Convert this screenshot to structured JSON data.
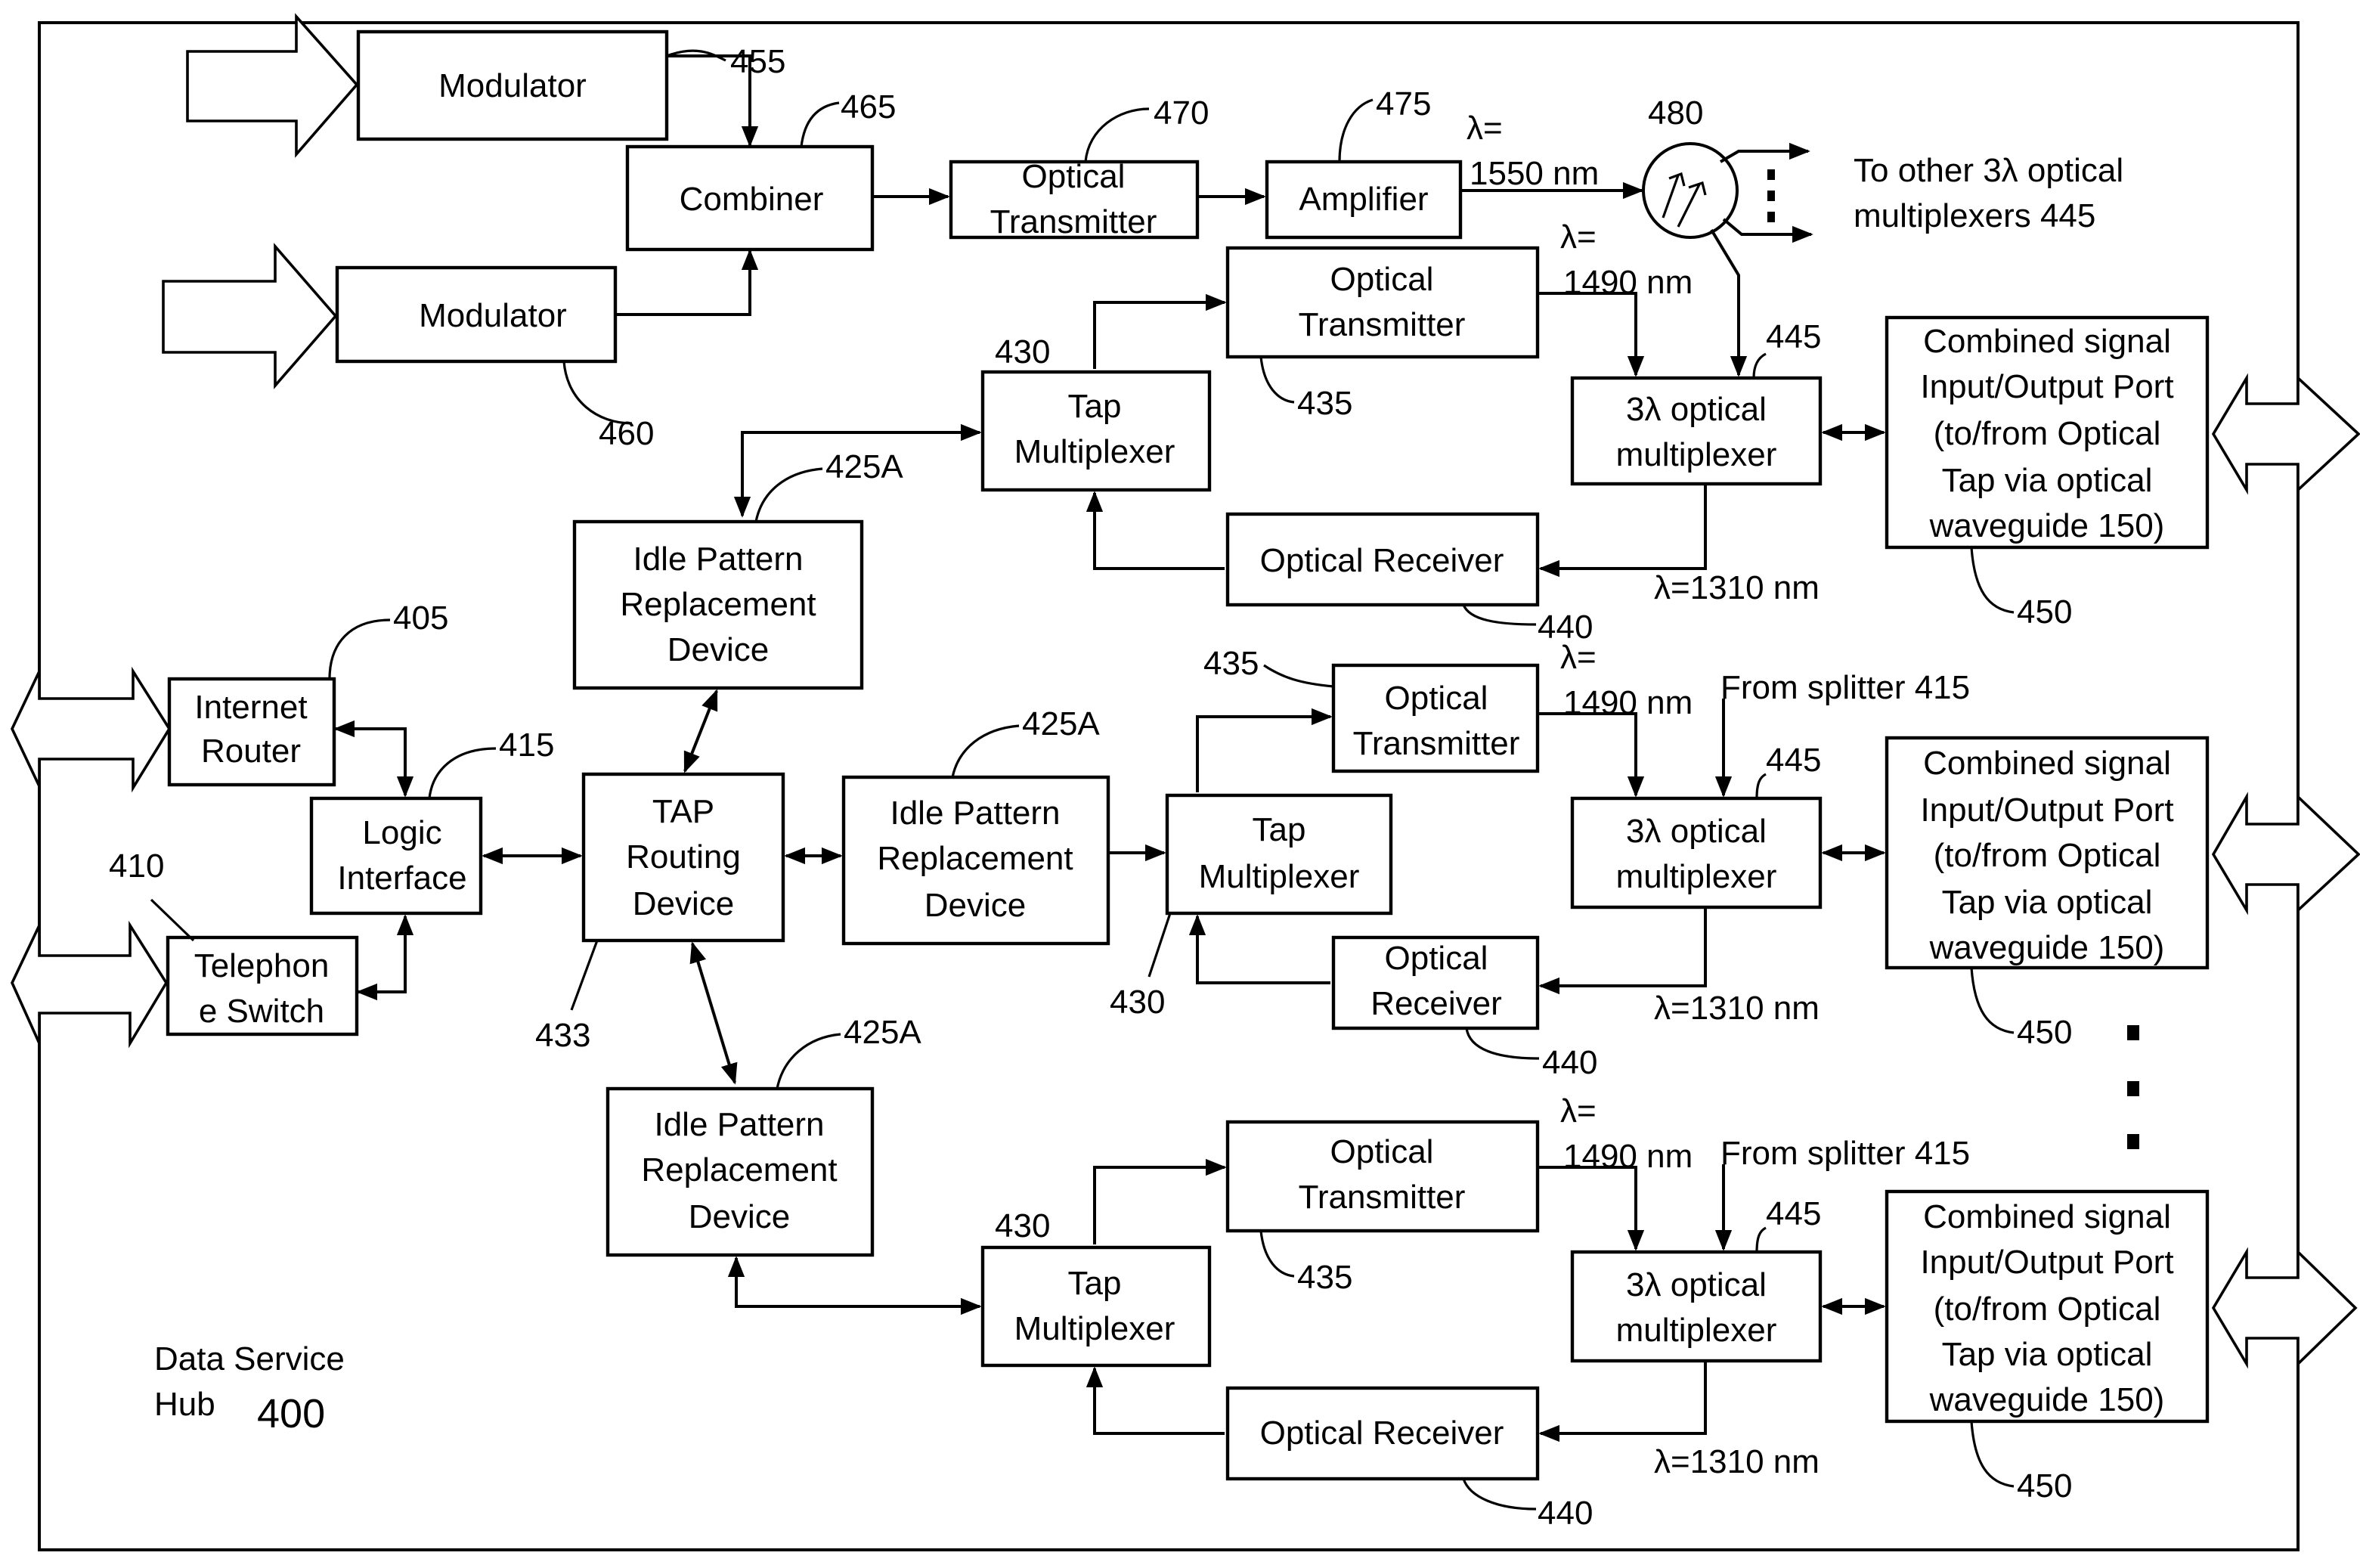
{
  "figure": {
    "title": "Data Service Hub",
    "title_lines": [
      "Data Service",
      "Hub"
    ],
    "ref": "400"
  },
  "blocks": {
    "modulator_top": {
      "lines": [
        "Modulator"
      ],
      "ref": "455"
    },
    "modulator_bottom": {
      "lines": [
        "Modulator"
      ],
      "ref": "460"
    },
    "combiner": {
      "lines": [
        "Combiner"
      ],
      "ref": "465"
    },
    "optical_transmitter_top": {
      "lines": [
        "Optical",
        "Transmitter"
      ],
      "ref": "470"
    },
    "amplifier": {
      "lines": [
        "Amplifier"
      ],
      "ref": "475"
    },
    "splitter": {
      "ref": "480"
    },
    "internet_router": {
      "lines": [
        "Internet",
        "Router"
      ],
      "ref": "405"
    },
    "telephone_switch": {
      "lines": [
        "Telephon",
        "e Switch"
      ],
      "ref": "410"
    },
    "logic_interface": {
      "lines": [
        "Logic",
        "Interface"
      ],
      "ref": "415"
    },
    "tap_routing_device": {
      "lines": [
        "TAP",
        "Routing",
        "Device"
      ],
      "ref": "433"
    }
  },
  "channels": [
    {
      "idle": {
        "lines": [
          "Idle Pattern",
          "Replacement",
          "Device"
        ],
        "ref": "425A"
      },
      "tap_mux": {
        "lines": [
          "Tap",
          "Multiplexer"
        ],
        "ref": "430"
      },
      "tx": {
        "lines": [
          "Optical",
          "Transmitter"
        ],
        "ref": "435"
      },
      "rx": {
        "lines": [
          "Optical Receiver"
        ],
        "ref": "440"
      },
      "mux": {
        "lines": [
          "3λ optical",
          "multiplexer"
        ],
        "ref": "445"
      },
      "port": {
        "lines": [
          "Combined signal",
          "Input/Output Port",
          "(to/from Optical",
          "Tap via optical",
          "waveguide 150)"
        ],
        "ref": "450"
      },
      "lambda_tx": [
        "λ=",
        "1490 nm"
      ],
      "lambda_rx": "λ=1310 nm",
      "from_splitter": ""
    },
    {
      "idle": {
        "lines": [
          "Idle Pattern",
          "Replacement",
          "Device"
        ],
        "ref": "425A"
      },
      "tap_mux": {
        "lines": [
          "Tap",
          "Multiplexer"
        ],
        "ref": "430"
      },
      "tx": {
        "lines": [
          "Optical",
          "Transmitter"
        ],
        "ref": "435"
      },
      "rx": {
        "lines": [
          "Optical",
          "Receiver"
        ],
        "ref": "440"
      },
      "mux": {
        "lines": [
          "3λ optical",
          "multiplexer"
        ],
        "ref": "445"
      },
      "port": {
        "lines": [
          "Combined signal",
          "Input/Output Port",
          "(to/from Optical",
          "Tap via optical",
          "waveguide 150)"
        ],
        "ref": "450"
      },
      "lambda_tx": [
        "λ=",
        "1490 nm"
      ],
      "lambda_rx": "λ=1310 nm",
      "from_splitter": "From splitter 415"
    },
    {
      "idle": {
        "lines": [
          "Idle Pattern",
          "Replacement",
          "Device"
        ],
        "ref": "425A"
      },
      "tap_mux": {
        "lines": [
          "Tap",
          "Multiplexer"
        ],
        "ref": "430"
      },
      "tx": {
        "lines": [
          "Optical",
          "Transmitter"
        ],
        "ref": "435"
      },
      "rx": {
        "lines": [
          "Optical Receiver"
        ],
        "ref": "440"
      },
      "mux": {
        "lines": [
          "3λ optical",
          "multiplexer"
        ],
        "ref": "445"
      },
      "port": {
        "lines": [
          "Combined signal",
          "Input/Output Port",
          "(to/from Optical",
          "Tap via optical",
          "waveguide 150)"
        ],
        "ref": "450"
      },
      "lambda_tx": [
        "λ=",
        "1490 nm"
      ],
      "lambda_rx": "λ=1310 nm",
      "from_splitter": "From splitter 415"
    }
  ],
  "labels": {
    "lambda_1550": [
      "λ=",
      "1550 nm"
    ],
    "to_other": [
      "To other 3λ optical",
      "multiplexers 445"
    ]
  },
  "icons": {
    "splitter": "optical-splitter-icon",
    "io_arrow": "double-headed-arrow-icon",
    "input_arrow": "block-arrow-icon",
    "continuation": "vertical-ellipsis-icon"
  }
}
